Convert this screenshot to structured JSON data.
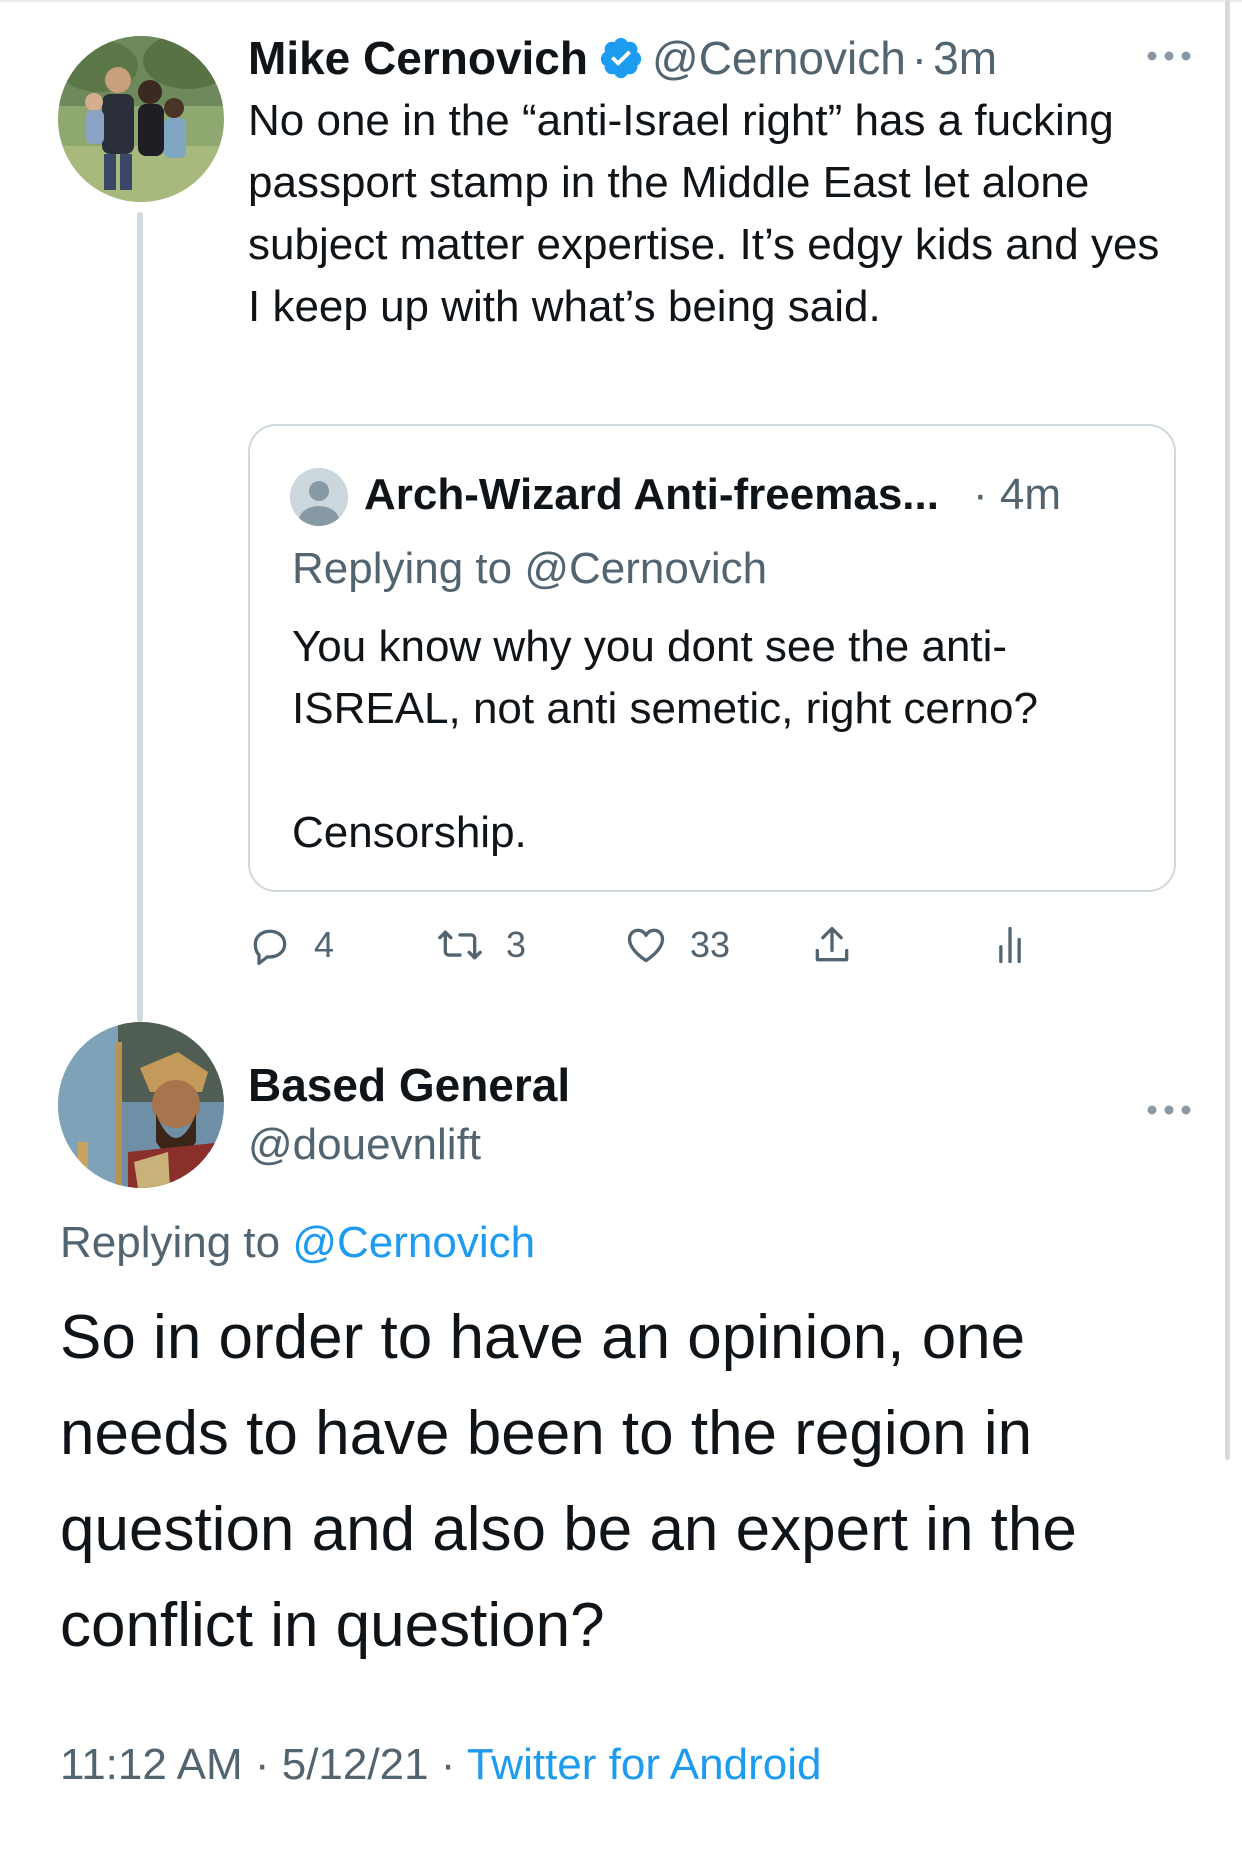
{
  "colors": {
    "accent": "#1d9bf0",
    "secondary_text": "#536471",
    "primary_text": "#0f1419",
    "border": "#cfd9de"
  },
  "tweet1": {
    "author_name": "Mike Cernovich",
    "verified": true,
    "handle": "@Cernovich",
    "separator": "·",
    "time": "3m",
    "text": "No one in the “anti-Israel right” has a fucking passport stamp in the Middle East let alone subject matter expertise. It’s edgy kids and yes I keep up with what’s being said.",
    "quote": {
      "author_name": "Arch-Wizard Anti-freemas...",
      "time": "· 4m",
      "replying_to": "Replying to @Cernovich",
      "text": "You know why you dont see the anti-ISREAL, not anti semetic, right cerno?\n\nCensorship."
    },
    "actions": {
      "reply_count": "4",
      "retweet_count": "3",
      "like_count": "33"
    }
  },
  "tweet2": {
    "author_name": "Based General",
    "handle": "@douevnlift",
    "replying_prefix": "Replying to ",
    "replying_mention": "@Cernovich",
    "text": "So in order to have an opinion, one needs to have been to the region in question and also be an expert in the conflict in question?",
    "timestamp": "11:12 AM · 5/12/21 · ",
    "source": "Twitter for Android"
  },
  "icons": {
    "verified": "verified-badge-icon",
    "more": "more-options-icon",
    "reply": "reply-icon",
    "retweet": "retweet-icon",
    "like": "heart-icon",
    "share": "share-icon",
    "analytics": "analytics-icon"
  }
}
